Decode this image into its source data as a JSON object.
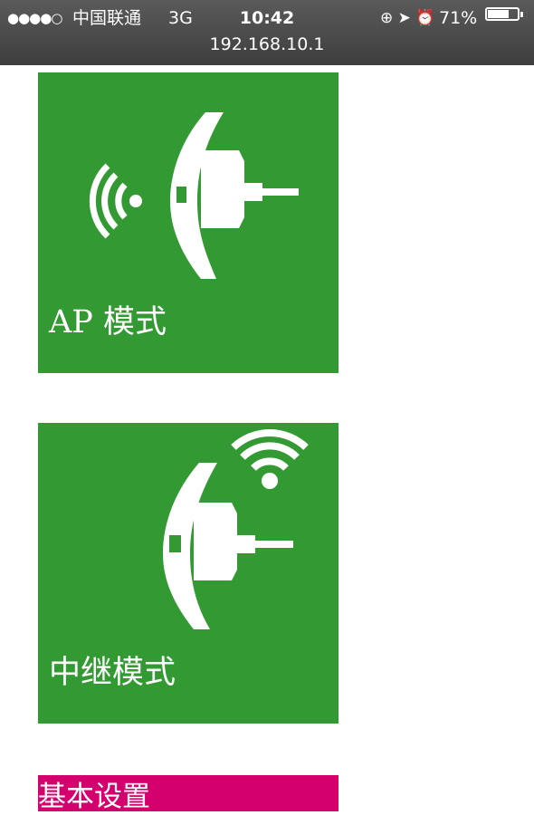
{
  "status_bar": {
    "signal": "●●●●○",
    "carrier": "中国联通",
    "network": "3G",
    "time": "10:42",
    "icons": "⊕ ➤ ⏰",
    "battery_percent": "71%",
    "battery_level": 0.71
  },
  "address_bar": {
    "url": "192.168.10.1"
  },
  "tiles": [
    {
      "label": "AP 模式",
      "icon": "wifi-extender-ap-icon",
      "color": "#339933"
    },
    {
      "label": "中继模式",
      "icon": "wifi-extender-repeater-icon",
      "color": "#339933"
    },
    {
      "label": "基本设置",
      "color": "#d4006e"
    }
  ]
}
